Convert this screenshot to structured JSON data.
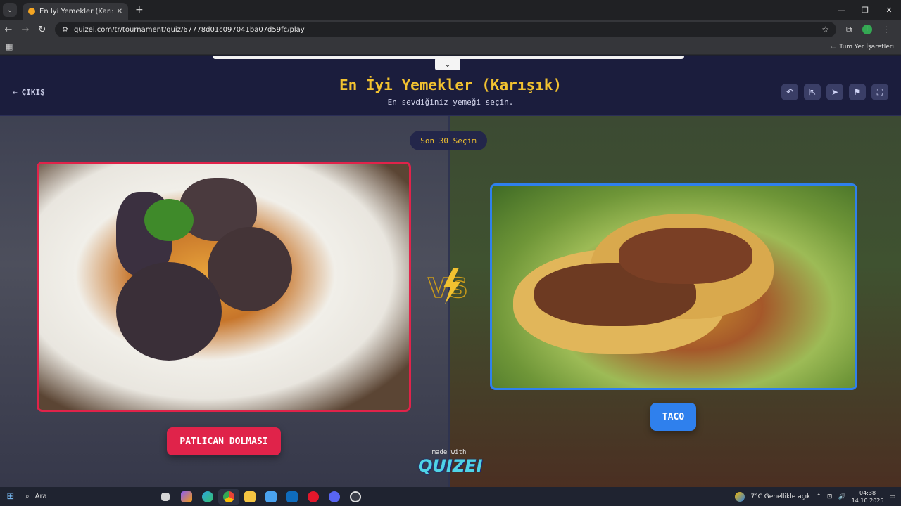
{
  "browser": {
    "tab_title": "En İyi Yemekler (Karışık) - Quizei",
    "tab_close": "✕",
    "new_tab": "+",
    "url": "quizei.com/tr/tournament/quiz/67778d01c097041ba07d59fc/play",
    "bookmarks_all": "Tüm Yer İşaretleri",
    "profile_initial": "i"
  },
  "header": {
    "exit_label": "ÇIKIŞ",
    "title": "En İyi Yemekler (Karışık)",
    "subtitle": "En sevdiğiniz yemeği seçin."
  },
  "round_badge": "Son 30 Seçim",
  "choices": {
    "left": {
      "label": "PATLICAN DOLMASI",
      "color": "#e0234a"
    },
    "right": {
      "label": "TACO",
      "color": "#2f80ed"
    }
  },
  "footer": {
    "made_with": "made with",
    "brand": "QUIZEI"
  },
  "taskbar": {
    "search_label": "Ara",
    "weather": "7°C  Genellikle açık",
    "time": "04:38",
    "date": "14.10.2025"
  },
  "colors": {
    "accent_yellow": "#f2c230",
    "bg": "#1c1f3a"
  }
}
